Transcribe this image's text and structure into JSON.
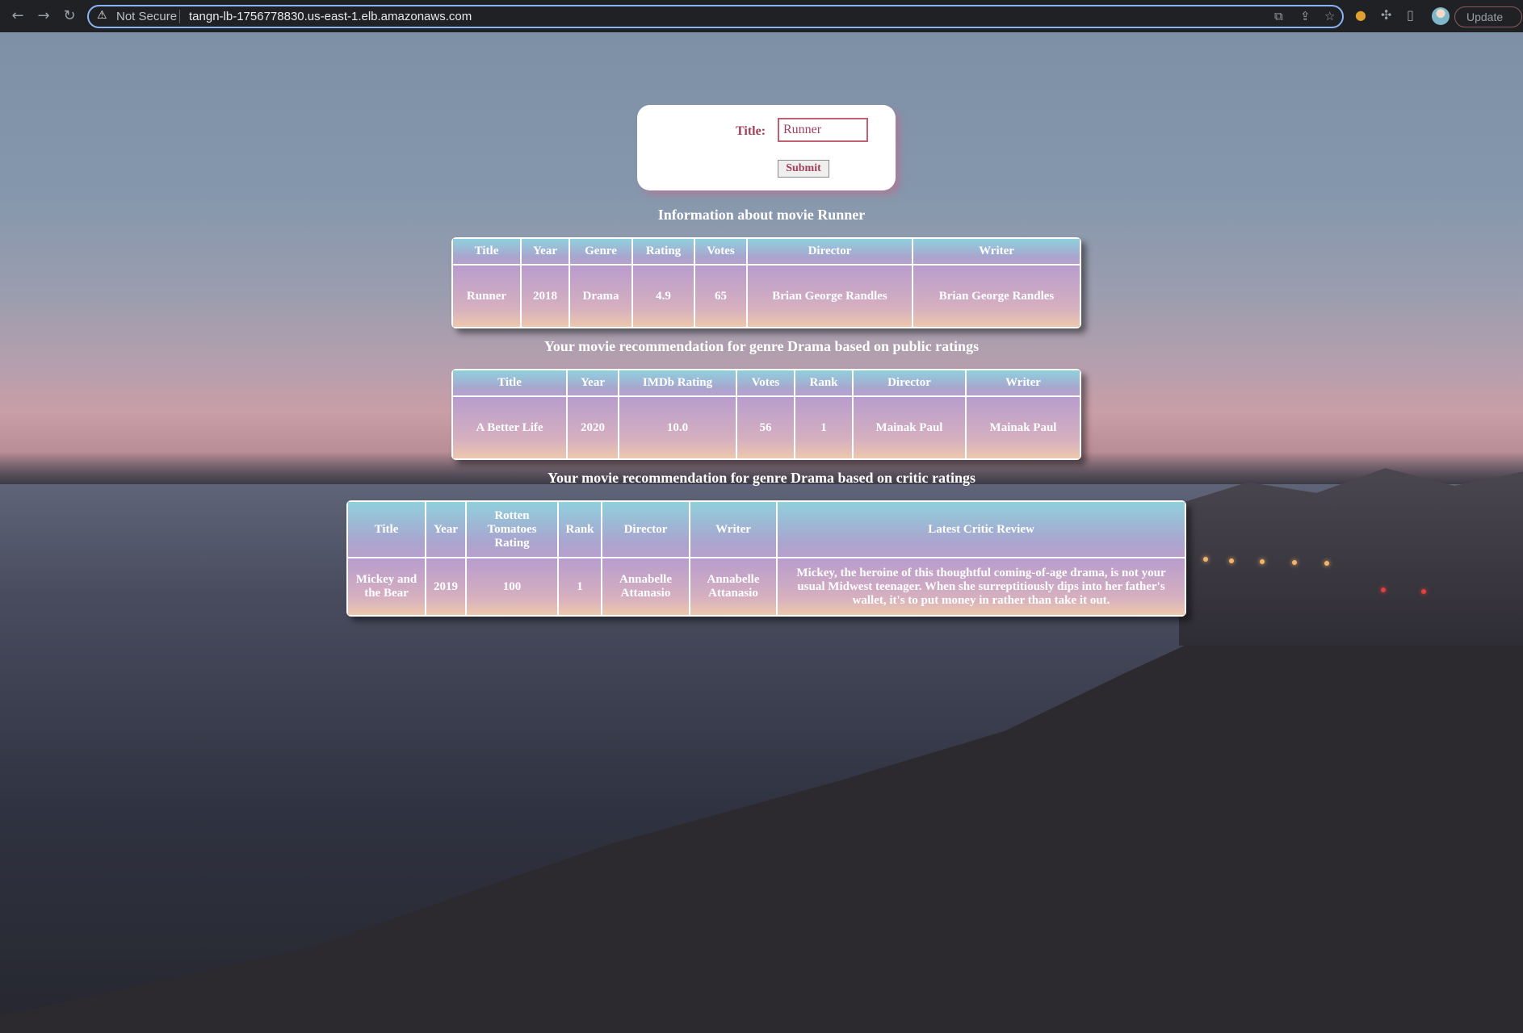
{
  "browser": {
    "security_label": "Not Secure",
    "url": "tangn-lb-1756778830.us-east-1.elb.amazonaws.com",
    "update_label": "Update"
  },
  "form": {
    "title_label": "Title:",
    "title_value": "Runner",
    "submit_label": "Submit"
  },
  "info_section": {
    "heading": "Information about movie Runner",
    "headers": [
      "Title",
      "Year",
      "Genre",
      "Rating",
      "Votes",
      "Director",
      "Writer"
    ],
    "rows": [
      [
        "Runner",
        "2018",
        "Drama",
        "4.9",
        "65",
        "Brian George Randles",
        "Brian George Randles"
      ]
    ]
  },
  "public_section": {
    "heading": "Your movie recommendation for genre Drama based on public ratings",
    "headers": [
      "Title",
      "Year",
      "IMDb Rating",
      "Votes",
      "Rank",
      "Director",
      "Writer"
    ],
    "rows": [
      [
        "A Better Life",
        "2020",
        "10.0",
        "56",
        "1",
        "Mainak Paul",
        "Mainak Paul"
      ]
    ]
  },
  "critic_section": {
    "heading": "Your movie recommendation for genre Drama based on critic ratings",
    "headers": [
      "Title",
      "Year",
      "Rotten Tomatoes Rating",
      "Rank",
      "Director",
      "Writer",
      "Latest Critic Review"
    ],
    "rows": [
      [
        "Mickey and the Bear",
        "2019",
        "100",
        "1",
        "Annabelle Attanasio",
        "Annabelle Attanasio",
        "Mickey, the heroine of this thoughtful coming-of-age drama, is not your usual Midwest teenager. When she surreptitiously dips into her father's wallet, it's to put money in rather than take it out."
      ]
    ]
  }
}
